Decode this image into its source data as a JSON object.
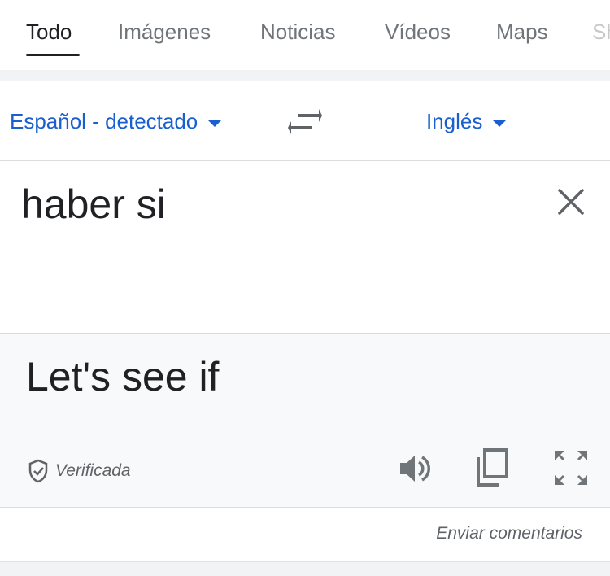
{
  "tabs": [
    {
      "label": "Todo",
      "active": true
    },
    {
      "label": "Imágenes",
      "active": false
    },
    {
      "label": "Noticias",
      "active": false
    },
    {
      "label": "Vídeos",
      "active": false
    },
    {
      "label": "Maps",
      "active": false
    },
    {
      "label": "Sh",
      "active": false
    }
  ],
  "translator": {
    "source_lang": "Español - detectado",
    "target_lang": "Inglés",
    "source_text": "haber si",
    "translated_text": "Let's see if",
    "verified_label": "Verificada",
    "feedback_link": "Enviar comentarios"
  },
  "icons": {
    "swap": "swap-arrows-icon",
    "clear": "close-icon",
    "source_speaker": "speaker-icon",
    "mic": "microphone-icon",
    "verified": "shield-check-icon",
    "target_speaker": "speaker-icon",
    "copy": "copy-icon",
    "fullscreen": "fullscreen-icon"
  },
  "colors": {
    "accent": "#1a5fd0",
    "text": "#202124",
    "muted": "#5f6368",
    "icon": "#70757a",
    "target_bg": "#f8f9fa"
  }
}
